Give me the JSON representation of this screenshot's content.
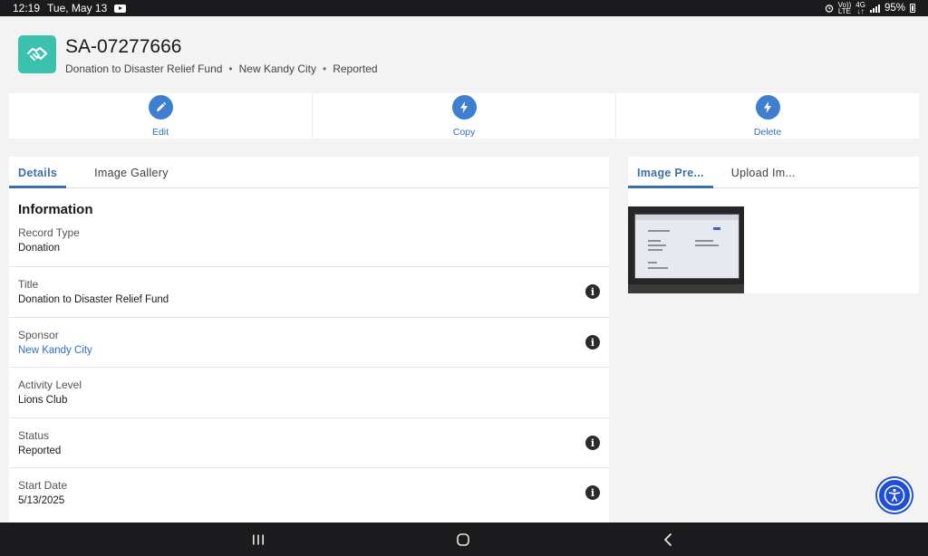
{
  "status_bar": {
    "time": "12:19",
    "date": "Tue, May 13",
    "net_top": "Vo))",
    "net_bottom": "LTE",
    "data_top": "4G",
    "data_bottom": "↓↑",
    "battery": "95%"
  },
  "header": {
    "record_number": "SA-07277666",
    "title": "Donation to Disaster Relief Fund",
    "sponsor": "New Kandy City",
    "status": "Reported",
    "separator": "•"
  },
  "actions": [
    {
      "label": "Edit",
      "icon": "pencil-icon"
    },
    {
      "label": "Copy",
      "icon": "lightning-icon"
    },
    {
      "label": "Delete",
      "icon": "lightning-icon"
    }
  ],
  "details": {
    "tabs": [
      "Details",
      "Image Gallery"
    ],
    "section_title": "Information",
    "fields": [
      {
        "label": "Record Type",
        "value": "Donation"
      },
      {
        "label": "Title",
        "value": "Donation to Disaster Relief Fund"
      },
      {
        "label": "Sponsor",
        "value": "New Kandy City"
      },
      {
        "label": "Activity Level",
        "value": "Lions Club"
      },
      {
        "label": "Status",
        "value": "Reported"
      },
      {
        "label": "Start Date",
        "value": "5/13/2025"
      }
    ]
  },
  "image_panel": {
    "tabs": [
      "Image Pre...",
      "Upload Im..."
    ]
  },
  "colors": {
    "brand_icon": "#3bc1ae",
    "action_blue": "#3e7fd1",
    "link_blue": "#2f6fbf",
    "tab_active": "#3b6fa8",
    "a11y_fab": "#1f4fd6"
  }
}
